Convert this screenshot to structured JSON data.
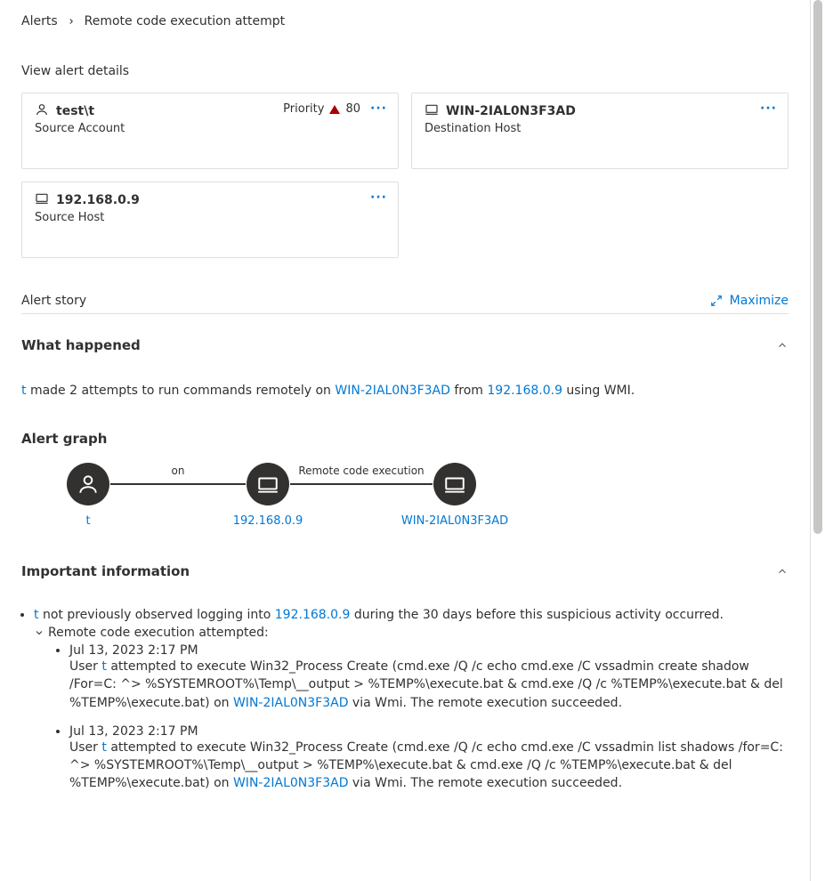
{
  "breadcrumb": {
    "root": "Alerts",
    "current": "Remote code execution attempt"
  },
  "details_label": "View alert details",
  "cards": {
    "source_account": {
      "title": "test\\t",
      "subtitle": "Source Account",
      "priority_label": "Priority",
      "priority_value": "80"
    },
    "dest_host": {
      "title": "WIN-2IAL0N3F3AD",
      "subtitle": "Destination Host"
    },
    "source_host": {
      "title": "192.168.0.9",
      "subtitle": "Source Host"
    }
  },
  "alert_story": {
    "label": "Alert story",
    "maximize": "Maximize"
  },
  "what_happened": {
    "heading": "What happened",
    "sentence_parts": {
      "user": "t",
      "p1": " made 2 attempts to run commands remotely on ",
      "host": "WIN-2IAL0N3F3AD",
      "p2": " from ",
      "ip": "192.168.0.9",
      "p3": " using WMI."
    }
  },
  "graph": {
    "heading": "Alert graph",
    "node1": "t",
    "edge1": "on",
    "node2": "192.168.0.9",
    "edge2": "Remote code execution",
    "node3": "WIN-2IAL0N3F3AD"
  },
  "important": {
    "heading": "Important information",
    "bullet1": {
      "user": "t",
      "p1": " not previously observed logging into ",
      "ip": "192.168.0.9",
      "p2": " during the 30 days before this suspicious activity occurred."
    },
    "expander_label": "Remote code execution attempted:",
    "attempts": [
      {
        "ts": "Jul 13, 2023 2:17 PM",
        "seg_a": "User ",
        "user": "t",
        "seg_b": " attempted to execute Win32_Process Create (cmd.exe /Q /c echo cmd.exe /C vssadmin create shadow /For=C: ^> %SYSTEMROOT%\\Temp\\__output > %TEMP%\\execute.bat & cmd.exe /Q /c %TEMP%\\execute.bat & del %TEMP%\\execute.bat) on ",
        "host": "WIN-2IAL0N3F3AD",
        "seg_c": " via Wmi. The remote execution succeeded."
      },
      {
        "ts": "Jul 13, 2023 2:17 PM",
        "seg_a": "User ",
        "user": "t",
        "seg_b": " attempted to execute Win32_Process Create (cmd.exe /Q /c echo cmd.exe /C vssadmin list shadows /for=C: ^> %SYSTEMROOT%\\Temp\\__output > %TEMP%\\execute.bat & cmd.exe /Q /c %TEMP%\\execute.bat & del %TEMP%\\execute.bat) on ",
        "host": "WIN-2IAL0N3F3AD",
        "seg_c": " via Wmi. The remote execution succeeded."
      }
    ]
  }
}
